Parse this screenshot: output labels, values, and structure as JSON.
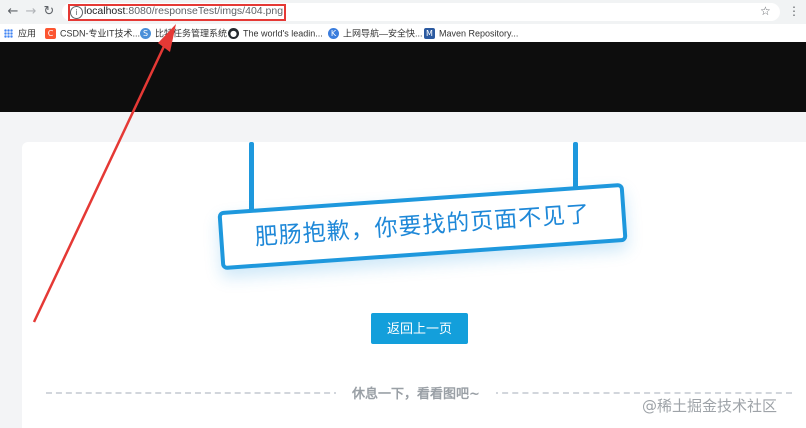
{
  "browser": {
    "url_host": "localhost",
    "url_path": ":8080/responseTest/imgs/404.png",
    "back_icon": "arrow-left-icon",
    "forward_icon": "arrow-right-icon",
    "reload_icon": "reload-icon"
  },
  "bookmarks": [
    {
      "label": "应用",
      "icon": "apps-grid-icon"
    },
    {
      "label": "CSDN-专业IT技术...",
      "icon": "csdn-icon",
      "icon_text": "C",
      "color": "#fc5531"
    },
    {
      "label": "比特任务管理系统",
      "icon": "bitr-icon",
      "icon_text": "S",
      "color": "#4a90d9"
    },
    {
      "label": "The world's leadin...",
      "icon": "github-icon",
      "icon_text": "●",
      "color": "#24292e"
    },
    {
      "label": "上网导航—安全快...",
      "icon": "navigation-icon",
      "icon_text": "K",
      "color": "#3b7ddd"
    },
    {
      "label": "Maven Repository...",
      "icon": "maven-icon",
      "icon_text": "M",
      "color": "#2c5aa0"
    }
  ],
  "page": {
    "sign_text": "肥肠抱歉，你要找的页面不见了",
    "back_button": "返回上一页",
    "rest_text": "休息一下，看看图吧~"
  },
  "watermark": "@稀土掘金技术社区",
  "colors": {
    "accent": "#1e98dd",
    "button": "#139fdb",
    "highlight": "#e53935"
  }
}
